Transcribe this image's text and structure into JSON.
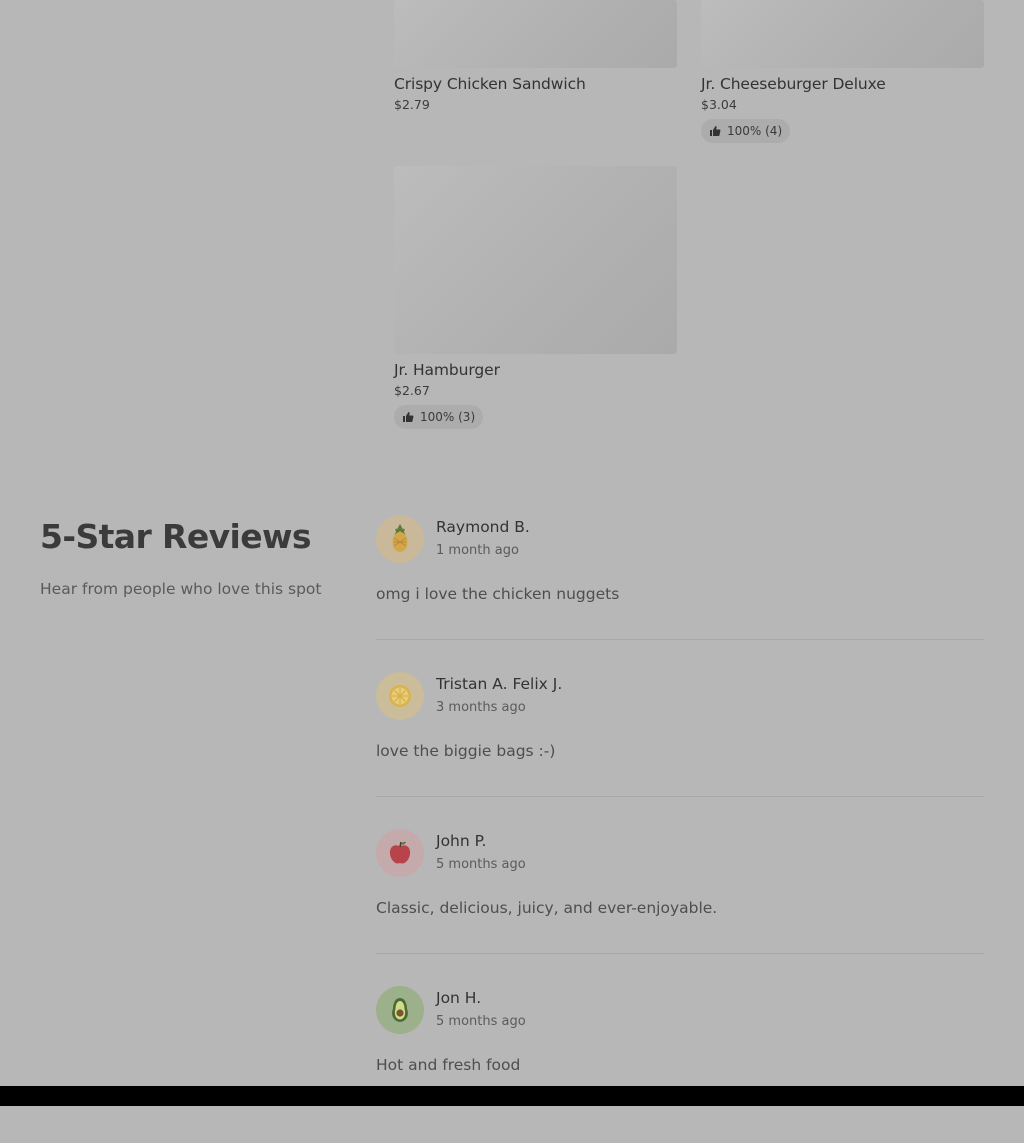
{
  "products": [
    {
      "name": "Crispy Chicken Sandwich",
      "price": "$2.79",
      "rating": ""
    },
    {
      "name": "Jr. Cheeseburger Deluxe",
      "price": "$3.04",
      "rating": "100% (4)"
    },
    {
      "name": "Jr. Hamburger",
      "price": "$2.67",
      "rating": "100% (3)"
    }
  ],
  "reviews_section": {
    "title": "5-Star Reviews",
    "subtitle": "Hear from people who love this spot"
  },
  "reviews": [
    {
      "name": "Raymond B.",
      "time": "1 month ago",
      "text": "omg i love the chicken nuggets",
      "avatar_icon": "pineapple-icon",
      "avatar_bg": "#c9b99a"
    },
    {
      "name": "Tristan A. Felix J.",
      "time": "3 months ago",
      "text": "love the biggie bags :-)",
      "avatar_icon": "lemon-icon",
      "avatar_bg": "#cbbd9a"
    },
    {
      "name": "John P.",
      "time": "5 months ago",
      "text": "Classic, delicious, juicy, and ever-enjoyable.",
      "avatar_icon": "apple-icon",
      "avatar_bg": "#c4aaaa"
    },
    {
      "name": "Jon H.",
      "time": "5 months ago",
      "text": "Hot and fresh food",
      "avatar_icon": "avocado-icon",
      "avatar_bg": "#9bb08b"
    }
  ],
  "icons": {
    "rating": "thumbs-up-icon"
  }
}
